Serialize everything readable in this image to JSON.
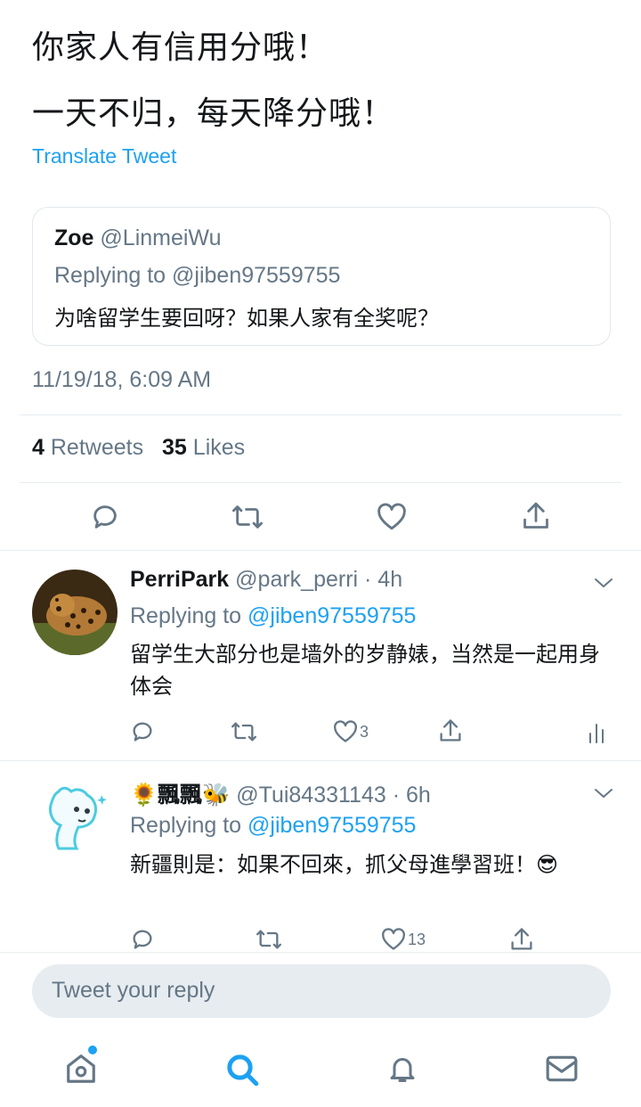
{
  "main_tweet": {
    "lines": [
      "你家人有信用分哦！",
      "一天不归，每天降分哦！"
    ],
    "translate_label": "Translate Tweet",
    "quoted": {
      "name": "Zoe",
      "handle": "@LinmeiWu",
      "replying_to": "Replying to @jiben97559755",
      "text": "为啥留学生要回呀？如果人家有全奖呢？"
    },
    "timestamp": "11/19/18, 6:09 AM",
    "retweets_count": "4",
    "retweets_label": "Retweets",
    "likes_count": "35",
    "likes_label": "Likes"
  },
  "replies": [
    {
      "name": "PerriPark",
      "handle": "@park_perri · 4h",
      "replying_prefix": "Replying to ",
      "replying_mention": "@jiben97559755",
      "text": "留学生大部分也是墙外的岁静婊，当然是一起用身体会",
      "like_count": "3"
    },
    {
      "name": "🌻飄飄🐝",
      "handle": "@Tui84331143 · 6h",
      "replying_prefix": "Replying to ",
      "replying_mention": "@jiben97559755",
      "text": "新疆則是：如果不回來，抓父母進學習班！😎",
      "like_count": "13"
    }
  ],
  "composer": {
    "placeholder": "Tweet your reply"
  },
  "colors": {
    "accent": "#1da1f2",
    "secondary_text": "#657786",
    "divider": "#e6ecf0"
  },
  "icons": [
    "reply-icon",
    "retweet-icon",
    "like-icon",
    "share-icon",
    "chevron-down-icon",
    "analytics-icon",
    "home-icon",
    "search-icon",
    "notifications-icon",
    "messages-icon"
  ]
}
